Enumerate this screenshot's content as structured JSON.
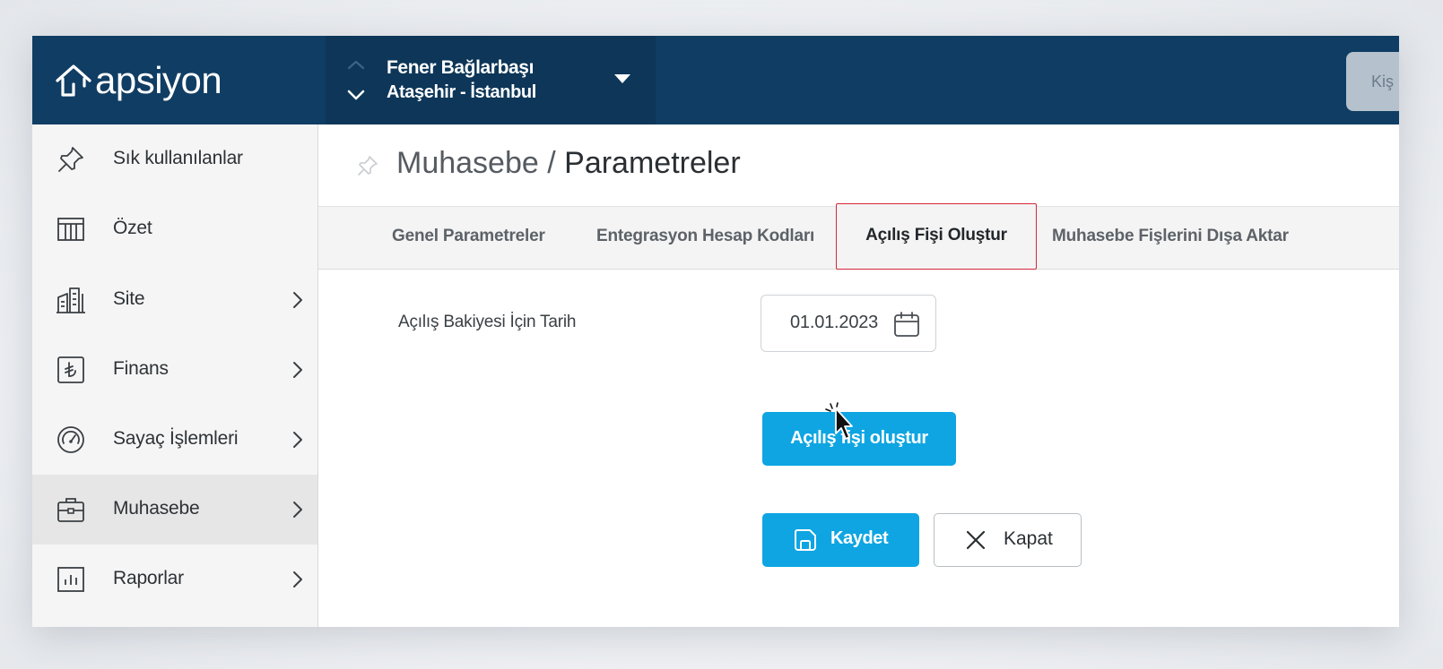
{
  "brand": {
    "logo_text": "apsiyon"
  },
  "site_selector": {
    "name": "Fener Bağlarbaşı",
    "location": "Ataşehir - İstanbul"
  },
  "top_button": {
    "label": "Kiş"
  },
  "sidebar": {
    "items": [
      {
        "label": "Sık kullanılanlar",
        "icon": "pin-icon",
        "has_children": false
      },
      {
        "label": "Özet",
        "icon": "table-icon",
        "has_children": false
      },
      {
        "label": "Site",
        "icon": "building-icon",
        "has_children": true
      },
      {
        "label": "Finans",
        "icon": "lira-icon",
        "has_children": true
      },
      {
        "label": "Sayaç İşlemleri",
        "icon": "gauge-icon",
        "has_children": true
      },
      {
        "label": "Muhasebe",
        "icon": "briefcase-icon",
        "has_children": true,
        "active": true
      },
      {
        "label": "Raporlar",
        "icon": "report-chart-icon",
        "has_children": true
      }
    ]
  },
  "breadcrumb": {
    "parent": "Muhasebe",
    "separator": "/",
    "current": "Parametreler"
  },
  "tabs": [
    {
      "label": "Genel Parametreler",
      "active": false
    },
    {
      "label": "Entegrasyon Hesap Kodları",
      "active": false
    },
    {
      "label": "Açılış Fişi Oluştur",
      "active": true
    },
    {
      "label": "Muhasebe Fişlerini Dışa Aktar",
      "active": false
    }
  ],
  "form": {
    "date_label": "Açılış Bakiyesi İçin Tarih",
    "date_value": "01.01.2023",
    "create_button": "Açılış fişi oluştur",
    "save_button": "Kaydet",
    "close_button": "Kapat"
  },
  "colors": {
    "topbar": "#103d63",
    "accent": "#0ea5e2",
    "active_tab_border": "#d6273a"
  }
}
